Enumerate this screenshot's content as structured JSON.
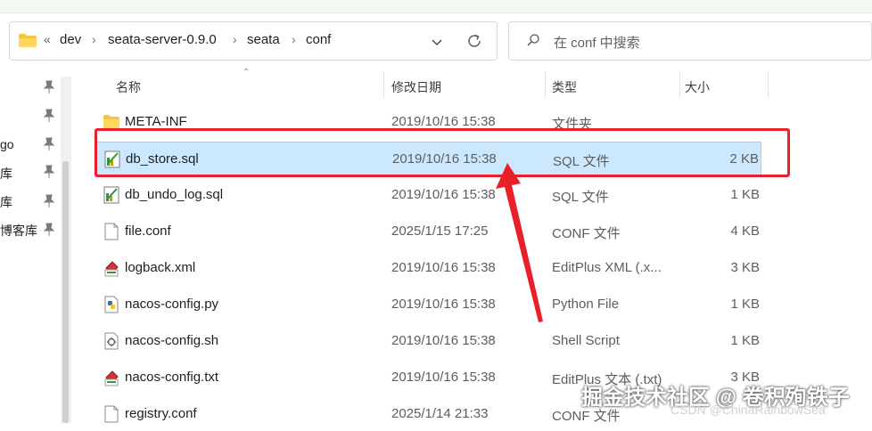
{
  "address": {
    "breadcrumb": [
      "dev",
      "seata-server-0.9.0",
      "seata",
      "conf"
    ],
    "overflow": "«"
  },
  "search": {
    "placeholder": "在 conf 中搜索"
  },
  "nav": {
    "items": [
      "go",
      "库",
      "库",
      "博客库"
    ]
  },
  "columns": {
    "name": "名称",
    "date": "修改日期",
    "type": "类型",
    "size": "大小"
  },
  "files": [
    {
      "name": "META-INF",
      "date": "2019/10/16 15:38",
      "type": "文件夹",
      "size": "",
      "icon": "folder-icon"
    },
    {
      "name": "db_store.sql",
      "date": "2019/10/16 15:38",
      "type": "SQL 文件",
      "size": "2 KB",
      "icon": "sql-file-icon",
      "selected": true
    },
    {
      "name": "db_undo_log.sql",
      "date": "2019/10/16 15:38",
      "type": "SQL 文件",
      "size": "1 KB",
      "icon": "sql-file-icon"
    },
    {
      "name": "file.conf",
      "date": "2025/1/15 17:25",
      "type": "CONF 文件",
      "size": "4 KB",
      "icon": "blank-file-icon"
    },
    {
      "name": "logback.xml",
      "date": "2019/10/16 15:38",
      "type": "EditPlus XML (.x...",
      "size": "3 KB",
      "icon": "editplus-file-icon"
    },
    {
      "name": "nacos-config.py",
      "date": "2019/10/16 15:38",
      "type": "Python File",
      "size": "1 KB",
      "icon": "python-file-icon"
    },
    {
      "name": "nacos-config.sh",
      "date": "2019/10/16 15:38",
      "type": "Shell Script",
      "size": "1 KB",
      "icon": "shell-file-icon"
    },
    {
      "name": "nacos-config.txt",
      "date": "2019/10/16 15:38",
      "type": "EditPlus 文本 (.txt)",
      "size": "3 KB",
      "icon": "editplus-file-icon"
    },
    {
      "name": "registry.conf",
      "date": "2025/1/14 21:33",
      "type": "CONF 文件",
      "size": "",
      "icon": "blank-file-icon"
    }
  ],
  "watermark": {
    "main": "掘金技术社区 @ 卷积殉铁子",
    "sub": "CSDN @ChinaRainbowSea"
  },
  "colors": {
    "selection": "#cce8ff",
    "highlight": "#e8202a",
    "accent": "#0067c0"
  }
}
